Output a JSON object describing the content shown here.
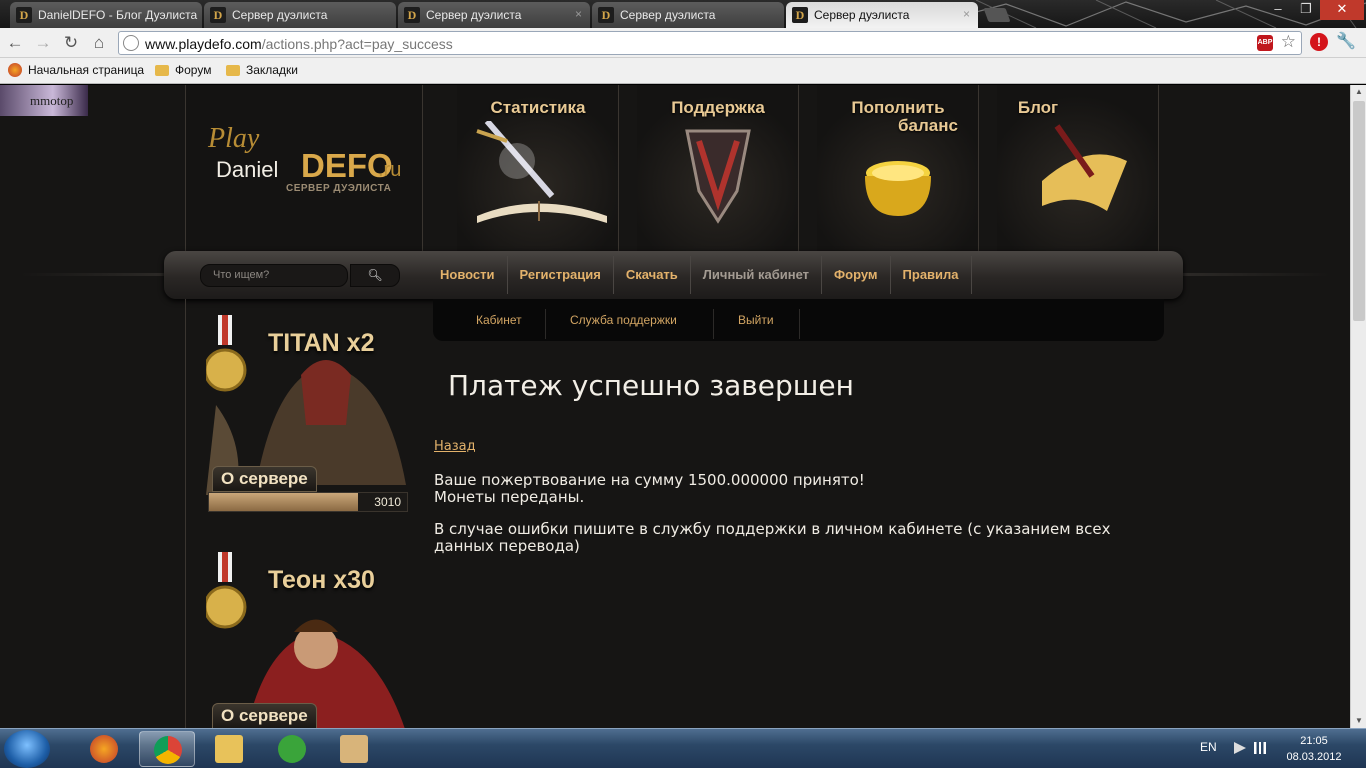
{
  "browser": {
    "tabs": [
      {
        "title": "DanielDEFO - Блог Дуэлиста",
        "active": false
      },
      {
        "title": "Сервер дуэлиста",
        "active": false
      },
      {
        "title": "Сервер дуэлиста",
        "active": false
      },
      {
        "title": "Сервер дуэлиста",
        "active": false
      },
      {
        "title": "Сервер дуэлиста",
        "active": true
      }
    ],
    "tab_favicon": "D",
    "tab_close": "×",
    "window_controls": {
      "minimize": "–",
      "maximize": "❐",
      "close": "✕"
    },
    "url_host": "www.playdefo.com",
    "url_path": "/actions.php?act=pay_success",
    "abp_label": "ABP",
    "bookmarks": [
      "Начальная страница",
      "Форум",
      "Закладки"
    ]
  },
  "site": {
    "banner_text": "mmotop",
    "logo": {
      "play": "Play",
      "daniel": "Daniel",
      "defo": "DEFO",
      "ru": ".ru",
      "subtitle": "СЕРВЕР ДУЭЛИСТА"
    },
    "header_cards": [
      {
        "title": "Статистика",
        "icon": "sword-book-icon"
      },
      {
        "title": "Поддержка",
        "icon": "shield-icon"
      },
      {
        "title_line1": "Пополнить",
        "title_line2": "баланс",
        "icon": "gold-pot-icon"
      },
      {
        "title": "Блог",
        "icon": "scroll-quill-icon"
      }
    ],
    "search": {
      "placeholder": "Что ищем?",
      "button_icon": "search-icon"
    },
    "menu": [
      "Новости",
      "Регистрация",
      "Скачать",
      "Личный кабинет",
      "Форум",
      "Правила"
    ],
    "subnav": [
      "Кабинет",
      "Служба поддержки",
      "Выйти"
    ],
    "promos": [
      {
        "title": "TITAN x2",
        "label": "О сервере",
        "count": "3010",
        "progress": 0.75
      },
      {
        "title": "Теон x30",
        "label": "О сервере"
      }
    ]
  },
  "content": {
    "heading": "Платеж успешно завершен",
    "back_link": "Назад",
    "line1": "Ваше пожертвование на сумму 1500.000000 принято!",
    "line2": "Монеты переданы.",
    "line3": "В случае ошибки пишите в службу поддержки в личном кабинете (с указанием всех данных перевода)"
  },
  "taskbar": {
    "language": "EN",
    "time": "21:05",
    "date": "08.03.2012",
    "apps": [
      "firefox",
      "chrome",
      "explorer",
      "utorrent",
      "game"
    ]
  },
  "colors": {
    "accent_gold": "#e3b26b",
    "page_bg": "#161514",
    "text": "#f0ece4"
  }
}
